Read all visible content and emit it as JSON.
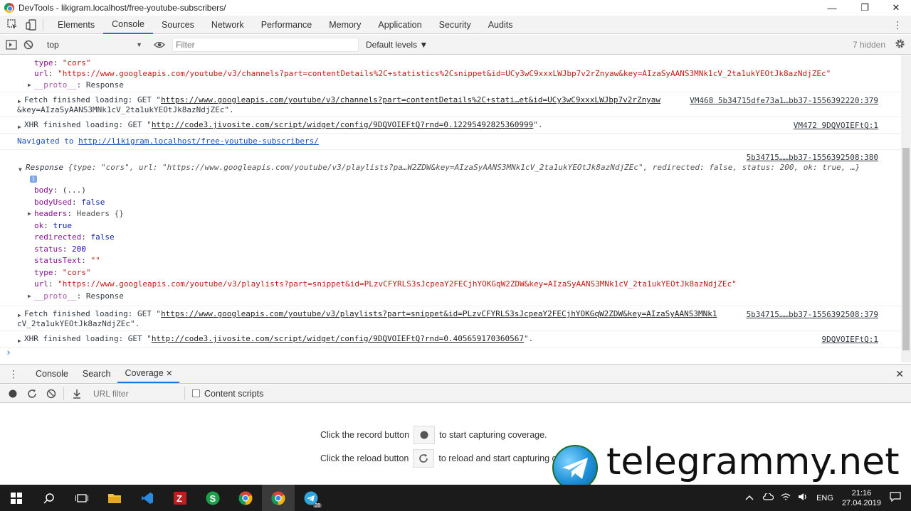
{
  "window": {
    "title": "DevTools - likigram.localhost/free-youtube-subscribers/",
    "controls": [
      "—",
      "❐",
      "✕"
    ]
  },
  "devtools_tabs": [
    "Elements",
    "Console",
    "Sources",
    "Network",
    "Performance",
    "Memory",
    "Application",
    "Security",
    "Audits"
  ],
  "active_tab": "Console",
  "console_toolbar": {
    "context": "top",
    "filter_placeholder": "Filter",
    "levels": "Default levels ▼",
    "hidden": "7 hidden"
  },
  "console": {
    "first_props": [
      {
        "key": "type",
        "value": "\"cors\""
      },
      {
        "key": "url",
        "value": "\"https://www.googleapis.com/youtube/v3/channels?part=contentDetails%2C+statistics%2Csnippet&id=UCy3wC9xxxLWJbp7v2rZnyaw&key=AIzaSyAANS3MNk1cV_2ta1ukYEOtJk8azNdjZEc\""
      }
    ],
    "proto1": "__proto__",
    "proto1_val": "Response",
    "fetch1_prefix": "Fetch finished loading: GET \"",
    "fetch1_url": "https://www.googleapis.com/youtube/v3/channels?part=contentDetails%2C+stati…et&id=UCy3wC9xxxLWJbp7v2rZnyaw",
    "fetch1_cont": "&key=AIzaSyAANS3MNk1cV_2ta1ukYEOtJk8azNdjZEc\".",
    "fetch1_src": "VM468 5b34715dfe73a1…bb37-1556392220:379",
    "xhr1_prefix": "XHR finished loading: GET \"",
    "xhr1_url": "http://code3.jivosite.com/script/widget/config/9DQVOIEFtQ?rnd=0.12295492825360999",
    "xhr1_suffix": "\".",
    "xhr1_src": "VM472 9DQVOIEFtQ:1",
    "nav_prefix": "Navigated to ",
    "nav_url": "http://likigram.localhost/free-youtube-subscribers/",
    "resp_src": "5b34715……bb37-1556392508:380",
    "resp_summary_label": "Response",
    "resp_summary": "{type: \"cors\", url: \"https://www.googleapis.com/youtube/v3/playlists?pa…W2ZDW&key=AIzaSyAANS3MNk1cV_2ta1ukYEOtJk8azNdjZEc\", redirected: false, status: 200, ok: true, …}",
    "info_badge": "i",
    "resp_props": [
      {
        "key": "body",
        "value": "(...)"
      },
      {
        "key": "bodyUsed",
        "value": "false"
      },
      {
        "key": "headers",
        "value": "Headers {}"
      },
      {
        "key": "ok",
        "value": "true"
      },
      {
        "key": "redirected",
        "value": "false"
      },
      {
        "key": "status",
        "value": "200"
      },
      {
        "key": "statusText",
        "value": "\"\""
      },
      {
        "key": "type",
        "value": "\"cors\""
      },
      {
        "key": "url",
        "value": "\"https://www.googleapis.com/youtube/v3/playlists?part=snippet&id=PLzvCFYRLS3sJcpeaY2FECjhYOKGqW2ZDW&key=AIzaSyAANS3MNk1cV_2ta1ukYEOtJk8azNdjZEc\""
      }
    ],
    "proto2": "__proto__",
    "proto2_val": "Response",
    "fetch2_prefix": "Fetch finished loading: GET \"",
    "fetch2_url": "https://www.googleapis.com/youtube/v3/playlists?part=snippet&id=PLzvCFYRLS3sJcpeaY2FECjhYOKGqW2ZDW&key=AIzaSyAANS3MNk1",
    "fetch2_cont": "cV_2ta1ukYEOtJk8azNdjZEc\".",
    "fetch2_src": "5b34715……bb37-1556392508:379",
    "xhr2_prefix": "XHR finished loading: GET \"",
    "xhr2_url": "http://code3.jivosite.com/script/widget/config/9DQVOIEFtQ?rnd=0.405659170360567",
    "xhr2_suffix": "\".",
    "xhr2_src": "9DQVOIEFtQ:1",
    "prompt": "›"
  },
  "drawer": {
    "tabs": [
      "Console",
      "Search",
      "Coverage"
    ],
    "active": "Coverage",
    "close": "✕",
    "url_filter_placeholder": "URL filter",
    "content_scripts": "Content scripts",
    "record_line_before": "Click the record button",
    "record_line_after": "to start capturing coverage.",
    "reload_line_before": "Click the reload button",
    "reload_line_after": "to reload and start capturing c"
  },
  "watermark": "telegrammy.net",
  "taskbar": {
    "language": "ENG",
    "time": "21:16",
    "date": "27.04.2019",
    "telegram_badge": "28"
  }
}
